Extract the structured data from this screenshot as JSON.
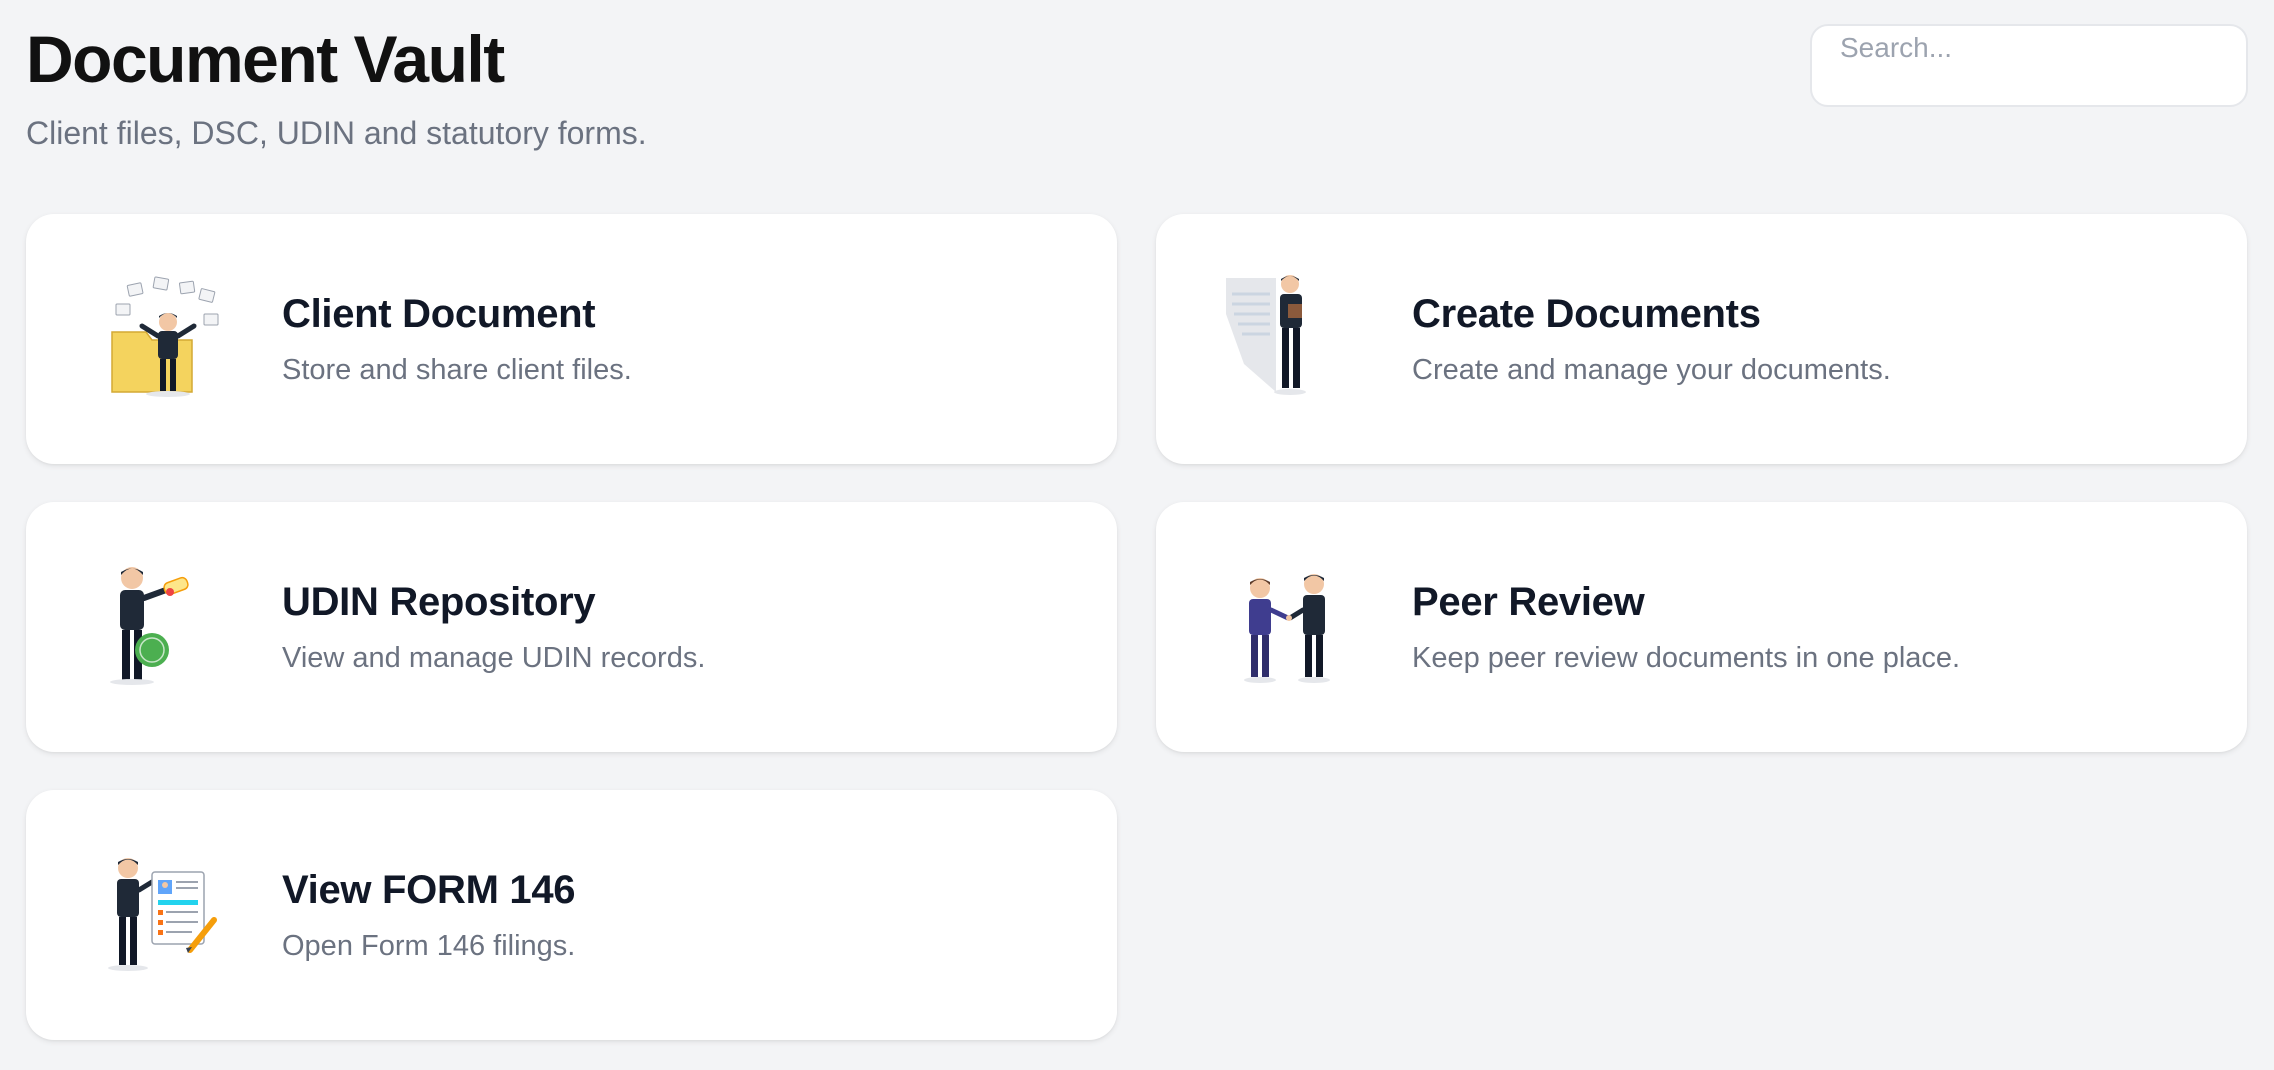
{
  "header": {
    "title": "Document Vault",
    "subtitle": "Client files, DSC, UDIN and statutory forms."
  },
  "search": {
    "placeholder": "Search..."
  },
  "cards": [
    {
      "title": "Client Document",
      "description": "Store and share client files.",
      "icon": "client-files-illustration"
    },
    {
      "title": "Create Documents",
      "description": "Create and manage your documents.",
      "icon": "create-documents-illustration"
    },
    {
      "title": "UDIN Repository",
      "description": "View and manage UDIN records.",
      "icon": "udin-certified-illustration"
    },
    {
      "title": "Peer Review",
      "description": "Keep peer review documents in one place.",
      "icon": "peer-handshake-illustration"
    },
    {
      "title": "View FORM 146",
      "description": "Open Form 146 filings.",
      "icon": "form-146-illustration"
    }
  ],
  "colors": {
    "background": "#f3f4f6",
    "card": "#ffffff",
    "title": "#111827",
    "muted": "#6b7280"
  }
}
